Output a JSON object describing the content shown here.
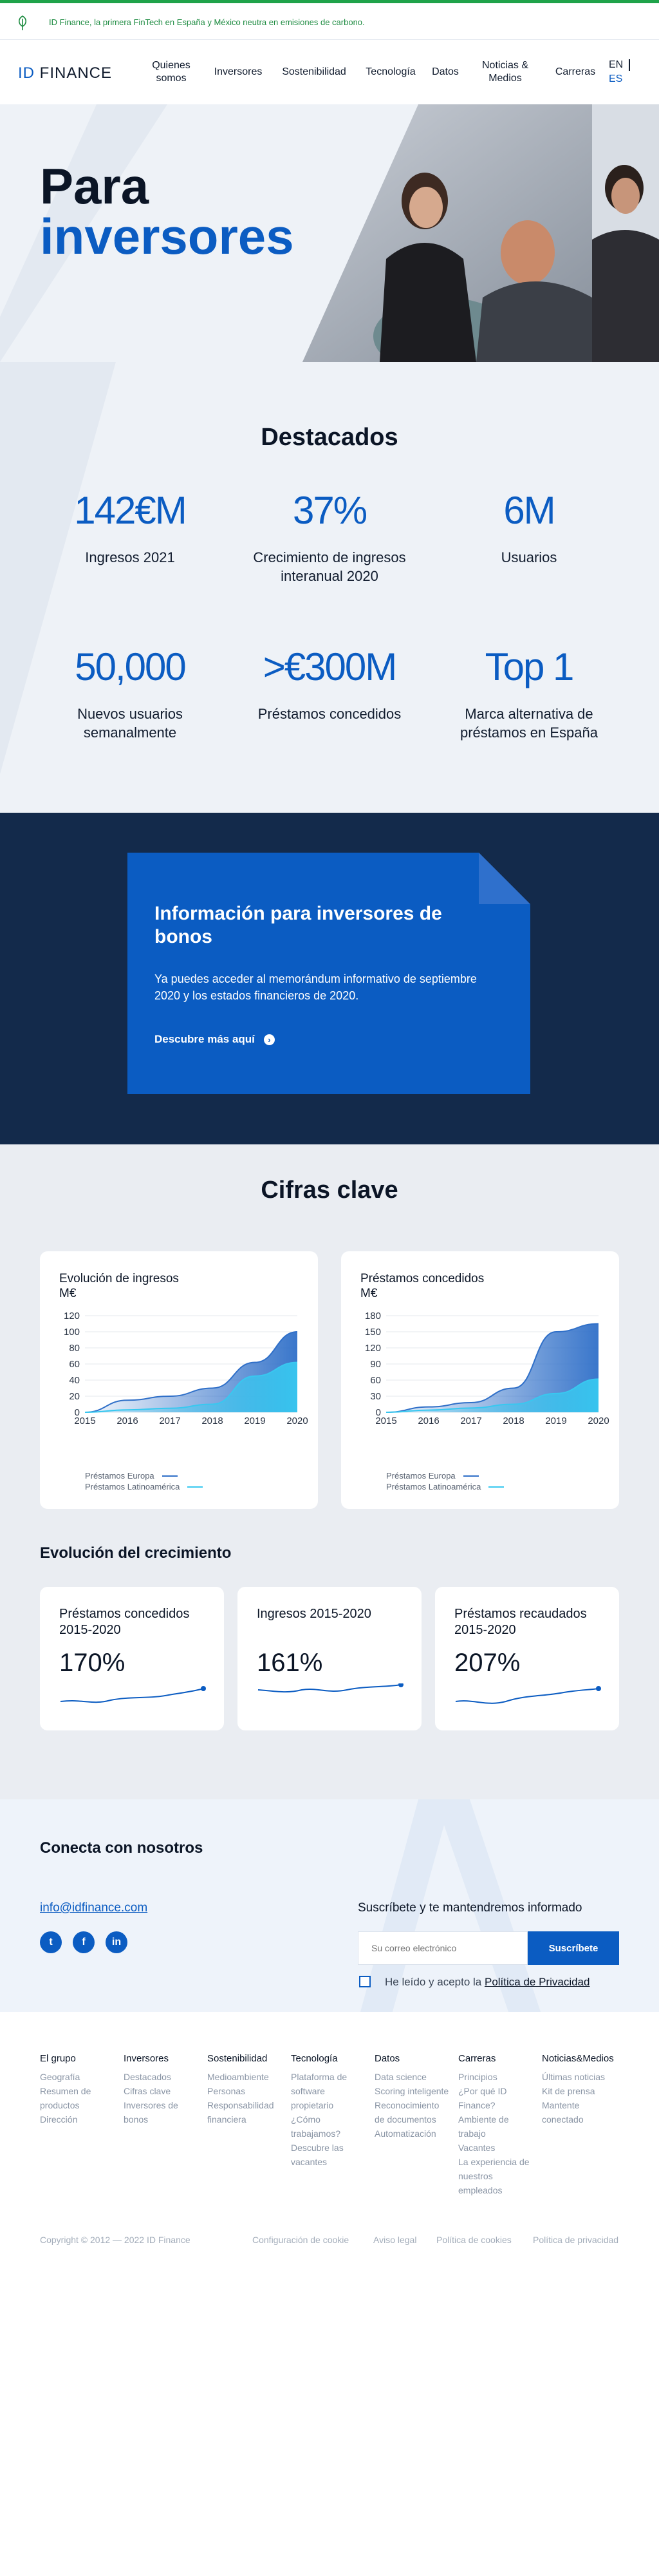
{
  "topbar": {
    "message": "ID Finance, la primera FinTech en España y México neutra en emisiones de carbono."
  },
  "nav": {
    "logo_left": "ID",
    "logo_right": "FINANCE",
    "items": [
      {
        "label": "Quienes somos"
      },
      {
        "label": "Inversores"
      },
      {
        "label": "Sostenibilidad"
      },
      {
        "label": "Tecnología"
      },
      {
        "label": "Datos"
      },
      {
        "label": "Noticias & Medios"
      },
      {
        "label": "Carreras"
      }
    ],
    "lang_en": "EN",
    "lang_es": "ES"
  },
  "hero": {
    "title_line1": "Para",
    "title_line2": "inversores"
  },
  "highlights": {
    "title": "Destacados",
    "stats": [
      {
        "value": "142€M",
        "label": "Ingresos 2021"
      },
      {
        "value": "37%",
        "label": "Crecimiento de ingresos interanual 2020"
      },
      {
        "value": "6M",
        "label": "Usuarios"
      },
      {
        "value": "50,000",
        "label": "Nuevos usuarios semanalmente"
      },
      {
        "value": ">€300M",
        "label": "Préstamos concedidos"
      },
      {
        "value": "Top 1",
        "label": "Marca alternativa de préstamos en España"
      }
    ]
  },
  "bonds": {
    "title": "Información para inversores de bonos",
    "text": "Ya puedes acceder al memorándum informativo de septiembre 2020 y los estados financieros de 2020.",
    "cta": "Descubre más aquí"
  },
  "keyfigures": {
    "title": "Cifras clave",
    "growth_title": "Evolución del crecimiento",
    "growth_cards": [
      {
        "title": "Préstamos concedidos 2015-2020",
        "value": "170%"
      },
      {
        "title": "Ingresos 2015-2020",
        "value": "161%"
      },
      {
        "title": "Préstamos recaudados 2015-2020",
        "value": "207%"
      }
    ]
  },
  "chart_data": [
    {
      "type": "area",
      "title": "Evolución de ingresos",
      "ylabel": "M€",
      "x": [
        "2015",
        "2016",
        "2017",
        "2018",
        "2019",
        "2020"
      ],
      "ylim": [
        0,
        120
      ],
      "yticks": [
        0,
        20,
        40,
        60,
        80,
        100,
        120
      ],
      "series": [
        {
          "name": "Préstamos Europa",
          "values": [
            0,
            15,
            20,
            30,
            62,
            100
          ],
          "color": "#2f6fc8"
        },
        {
          "name": "Préstamos Latinoamérica",
          "values": [
            0,
            3,
            5,
            10,
            45,
            62
          ],
          "color": "#38c8f0"
        }
      ],
      "grid": true,
      "legend": "bottom-left"
    },
    {
      "type": "area",
      "title": "Préstamos concedidos",
      "ylabel": "M€",
      "x": [
        "2015",
        "2016",
        "2017",
        "2018",
        "2019",
        "2020"
      ],
      "ylim": [
        0,
        180
      ],
      "yticks": [
        0,
        30,
        60,
        90,
        120,
        150,
        180
      ],
      "series": [
        {
          "name": "Préstamos Europa",
          "values": [
            0,
            10,
            18,
            45,
            150,
            165
          ],
          "color": "#2f6fc8"
        },
        {
          "name": "Préstamos Latinoamérica",
          "values": [
            0,
            4,
            8,
            15,
            35,
            62
          ],
          "color": "#38c8f0"
        }
      ],
      "grid": true,
      "legend": "bottom-left"
    }
  ],
  "contact": {
    "title": "Conecta con nosotros",
    "email": "info@idfinance.com",
    "newsletter_title": "Suscríbete y te mantendremos informado",
    "email_placeholder": "Su correo electrónico",
    "subscribe": "Suscríbete",
    "consent_prefix": "He leído y acepto la ",
    "consent_link": "Política de Privacidad",
    "social": [
      {
        "icon": "twitter-icon",
        "glyph": "t"
      },
      {
        "icon": "facebook-icon",
        "glyph": "f"
      },
      {
        "icon": "linkedin-icon",
        "glyph": "in"
      }
    ]
  },
  "footer": {
    "columns": [
      {
        "heading": "El grupo",
        "links": [
          "Geografía",
          "Resumen de productos",
          "Dirección"
        ]
      },
      {
        "heading": "Inversores",
        "links": [
          "Destacados",
          "Cifras clave",
          "Inversores de bonos"
        ]
      },
      {
        "heading": "Sostenibilidad",
        "links": [
          "Medioambiente",
          "Personas",
          "Responsabilidad financiera"
        ]
      },
      {
        "heading": "Tecnología",
        "links": [
          "Plataforma de software propietario",
          "¿Cómo trabajamos?",
          "Descubre las vacantes"
        ]
      },
      {
        "heading": "Datos",
        "links": [
          "Data science",
          "Scoring inteligente",
          "Reconocimiento de documentos",
          "Automatización"
        ]
      },
      {
        "heading": "Carreras",
        "links": [
          "Principios",
          "¿Por qué ID Finance?",
          "Ambiente de trabajo",
          "Vacantes",
          "La experiencia de nuestros empleados"
        ]
      },
      {
        "heading": "Noticias&Medios",
        "links": [
          "Últimas noticias",
          "Kit de prensa",
          "Mantente conectado"
        ]
      }
    ],
    "copyright": "Copyright © 2012 — 2022 ID Finance",
    "legal": [
      "Configuración de cookie",
      "Aviso legal",
      "Política de cookies",
      "Política de privacidad"
    ]
  },
  "colors": {
    "brand_blue": "#0b5cc2",
    "navy": "#132a4b",
    "green": "#1fa34a",
    "cyan": "#38c8f0"
  }
}
